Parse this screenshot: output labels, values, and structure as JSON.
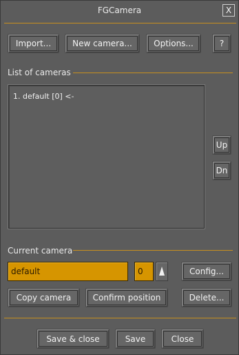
{
  "window": {
    "title": "FGCamera",
    "close_label": "X"
  },
  "toolbar": {
    "import_label": "Import...",
    "new_camera_label": "New camera...",
    "options_label": "Options...",
    "help_label": "?"
  },
  "cameras": {
    "section_label": "List of cameras",
    "items": [
      {
        "label": "1. default [0]  <-"
      }
    ],
    "up_label": "Up",
    "down_label": "Dn"
  },
  "current": {
    "section_label": "Current camera",
    "name_value": "default",
    "index_value": "0",
    "config_label": "Config...",
    "copy_label": "Copy camera",
    "confirm_label": "Confirm position",
    "delete_label": "Delete..."
  },
  "footer": {
    "save_close_label": "Save & close",
    "save_label": "Save",
    "close_label": "Close"
  },
  "colors": {
    "accent": "#d69500",
    "separator": "#c8901e",
    "background": "#5c5c5c"
  }
}
